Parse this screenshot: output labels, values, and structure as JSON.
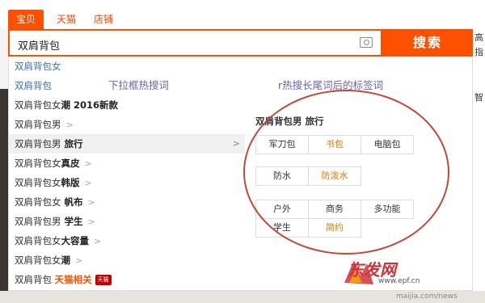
{
  "tabs": [
    {
      "label": "宝贝"
    },
    {
      "label": "天猫"
    },
    {
      "label": "店铺"
    }
  ],
  "search": {
    "value": "双肩背包",
    "button_label": "搜索"
  },
  "suggestions": [
    {
      "text": "双肩背包女",
      "bold": ""
    },
    {
      "text": "双肩背包",
      "bold": ""
    },
    {
      "text": "双肩背包女",
      "bold": "潮 2016新款"
    },
    {
      "text": "双肩背包男",
      "bold": ""
    },
    {
      "text": "双肩背包男",
      "bold": " 旅行"
    },
    {
      "text": "双肩背包女",
      "bold": "真皮"
    },
    {
      "text": "双肩背包女",
      "bold": "韩版"
    },
    {
      "text": "双肩背包女",
      "bold": " 帆布"
    },
    {
      "text": "双肩背包男",
      "bold": " 学生"
    },
    {
      "text": "双肩背包女",
      "bold": "大容量"
    },
    {
      "text": "双肩背包女",
      "bold": "潮"
    },
    {
      "text": "双肩背包 ",
      "bold": "天猫相关"
    }
  ],
  "tmall_badge": "天猫",
  "annotations": {
    "left": "下拉框热搜词",
    "right": "r热搜长尾词后的标签词"
  },
  "tag_panel": {
    "title": "双肩背包男 旅行",
    "group1": [
      "军刀包",
      "书包",
      "电脑包"
    ],
    "group2": [
      "防水",
      "防泼水"
    ],
    "group3_row1": [
      "户外",
      "商务",
      "多功能"
    ],
    "group3_row2": [
      "学生",
      "简约"
    ]
  },
  "right_strip": [
    "高",
    "指",
    "智"
  ],
  "watermark": {
    "logo_text": "东发网",
    "url": "www.epf.cn",
    "url2": "maijia.com/news"
  },
  "colors": {
    "brand": "#ff5000",
    "circle": "#c4463a",
    "annotation": "#6b63a8",
    "highlight_tag": "#d97a00"
  }
}
